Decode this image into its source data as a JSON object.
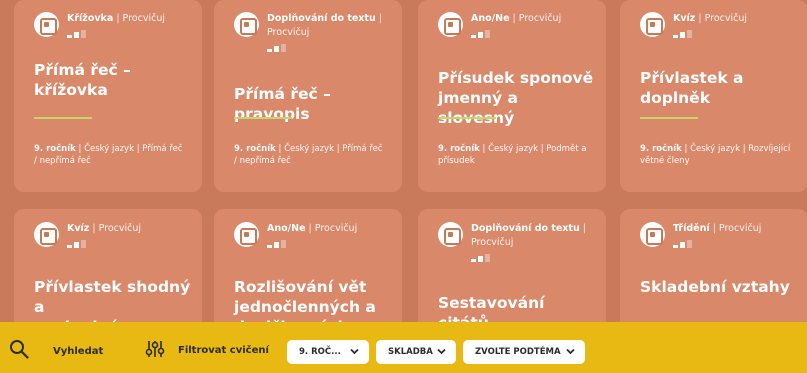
{
  "cards": [
    {
      "type": "Křížovka",
      "mode": "Procvičuj",
      "title_lines": [
        "Přímá řeč – křížovka"
      ],
      "grade": "9. ročník",
      "tags_rest": "| Český jazyk | Přímá řeč / nepřímá řeč"
    },
    {
      "type": "Doplňování do textu",
      "mode": "Procvičuj",
      "title_lines": [
        "Přímá řeč – pravopis"
      ],
      "grade": "9. ročník",
      "tags_rest": "| Český jazyk | Přímá řeč / nepřímá řeč"
    },
    {
      "type": "Ano/Ne",
      "mode": "Procvičuj",
      "title_lines": [
        "Přísudek sponově",
        "jmenný a slovesný"
      ],
      "grade": "9. ročník",
      "tags_rest": "| Český jazyk | Podmět a přísudek"
    },
    {
      "type": "Kvíz",
      "mode": "Procvičuj",
      "title_lines": [
        "Přívlastek a",
        "doplněk"
      ],
      "grade": "9. ročník",
      "tags_rest": "| Český jazyk | Rozvíjející větné členy"
    },
    {
      "type": "Kvíz",
      "mode": "Procvičuj",
      "title_lines": [
        "Přívlastek shodný a",
        "neshodný"
      ]
    },
    {
      "type": "Ano/Ne",
      "mode": "Procvičuj",
      "title_lines": [
        "Rozlišování vět",
        "jednočlenných a",
        "dvojčlenných"
      ]
    },
    {
      "type": "Doplňování do textu",
      "mode": "Procvičuj",
      "title_lines": [
        "Sestavování citátů"
      ]
    },
    {
      "type": "Třídění",
      "mode": "Procvičuj",
      "title_lines": [
        "Skladební vztahy"
      ]
    }
  ],
  "bottom_bar": {
    "search_label": "Vyhledat",
    "filter_label": "Filtrovat cvičení",
    "selects": [
      "9. ROČ...",
      "SKLADBA",
      "ZVOLTE PODTÉMA"
    ]
  },
  "colors": {
    "background": "#c97a5a",
    "card": "#d9886a",
    "accent_line": "#c4d66c",
    "bar": "#e8b913"
  }
}
